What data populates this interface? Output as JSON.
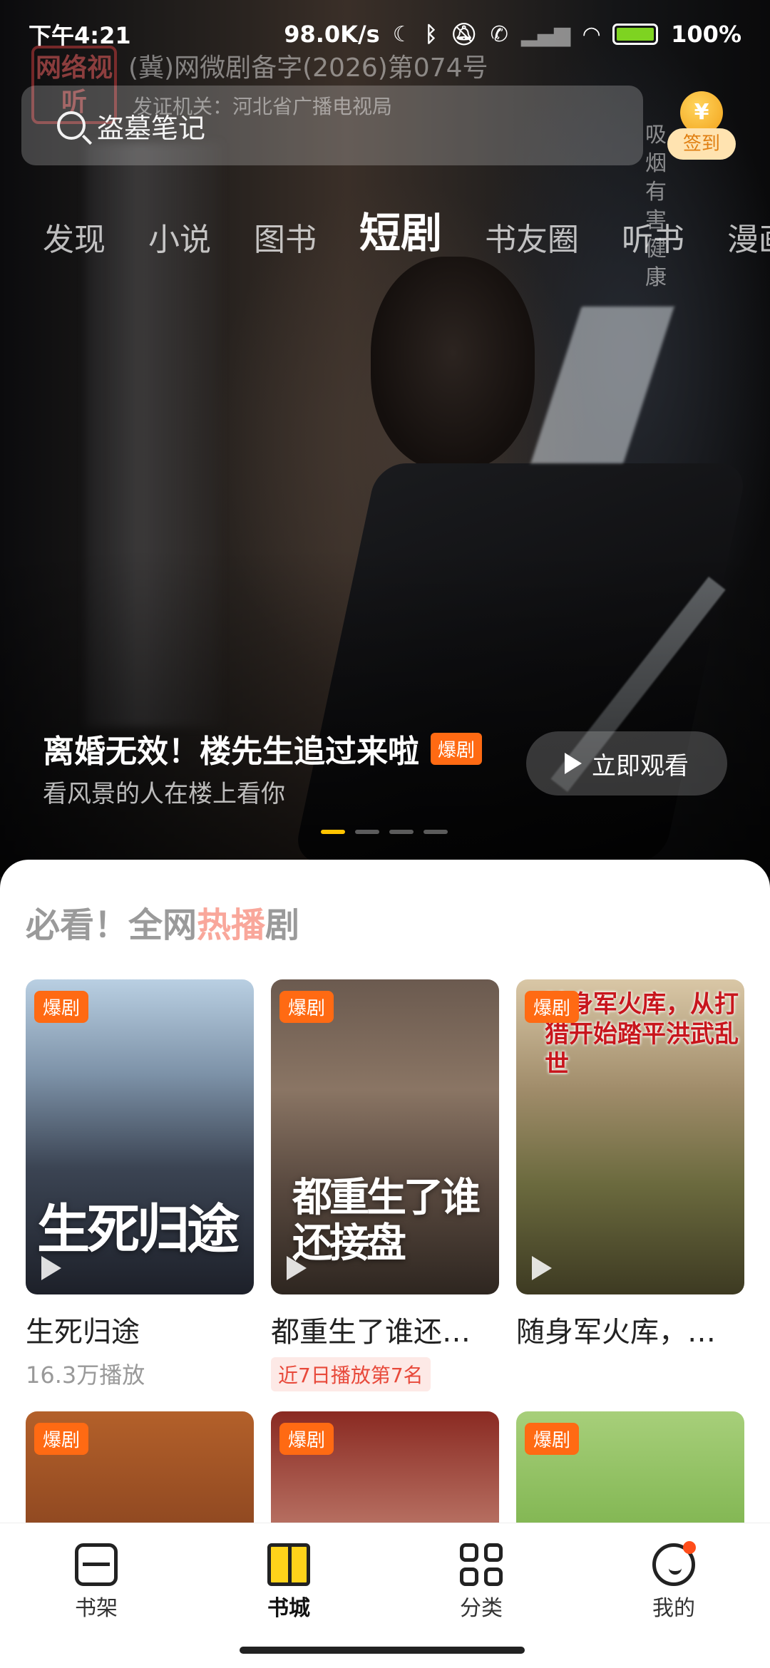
{
  "status_bar": {
    "time": "下午4:21",
    "net_speed": "98.0K/s",
    "battery": "100%"
  },
  "license": {
    "seal_text": "网络视听",
    "line1": "(冀)网微剧备字(2026)第074号",
    "line2": "发证机关：河北省广播电视局"
  },
  "search": {
    "placeholder": "盗墓笔记"
  },
  "signin": {
    "coin": "¥",
    "label": "签到"
  },
  "side_text": "吸烟有害健康",
  "tabs": [
    {
      "label": "发现"
    },
    {
      "label": "小说"
    },
    {
      "label": "图书"
    },
    {
      "label": "短剧",
      "active": true
    },
    {
      "label": "书友圈"
    },
    {
      "label": "听书"
    },
    {
      "label": "漫画"
    }
  ],
  "banner": {
    "title": "离婚无效！楼先生追过来啦",
    "badge": "爆剧",
    "subtitle": "看风景的人在楼上看你",
    "watch_label": "立即观看",
    "page_count": 4,
    "active_index": 0
  },
  "section": {
    "title_prefix": "必看！全网",
    "title_hot": "热播",
    "title_suffix": "剧"
  },
  "cards": [
    {
      "tag": "爆剧",
      "poster_text": "生死归途",
      "name": "生死归途",
      "meta": "16.3万播放",
      "rank": ""
    },
    {
      "tag": "爆剧",
      "poster_text": "都重生了谁还接盘",
      "name": "都重生了谁还…",
      "meta": "",
      "rank": "近7日播放第7名"
    },
    {
      "tag": "爆剧",
      "poster_text": "随身军火库，从打猎开始踏平洪武乱世",
      "name": "随身军火库，…",
      "meta": "",
      "rank": ""
    },
    {
      "tag": "爆剧"
    },
    {
      "tag": "爆剧"
    },
    {
      "tag": "爆剧"
    }
  ],
  "bottom_nav": [
    {
      "label": "书架",
      "icon": "bookshelf-icon"
    },
    {
      "label": "书城",
      "icon": "bookstore-icon",
      "active": true
    },
    {
      "label": "分类",
      "icon": "category-icon"
    },
    {
      "label": "我的",
      "icon": "profile-icon",
      "badge_dot": true
    }
  ],
  "colors": {
    "accent_orange": "#ff6a13",
    "active_yellow": "#ffd200",
    "hot_pink": "#f9a79b"
  }
}
